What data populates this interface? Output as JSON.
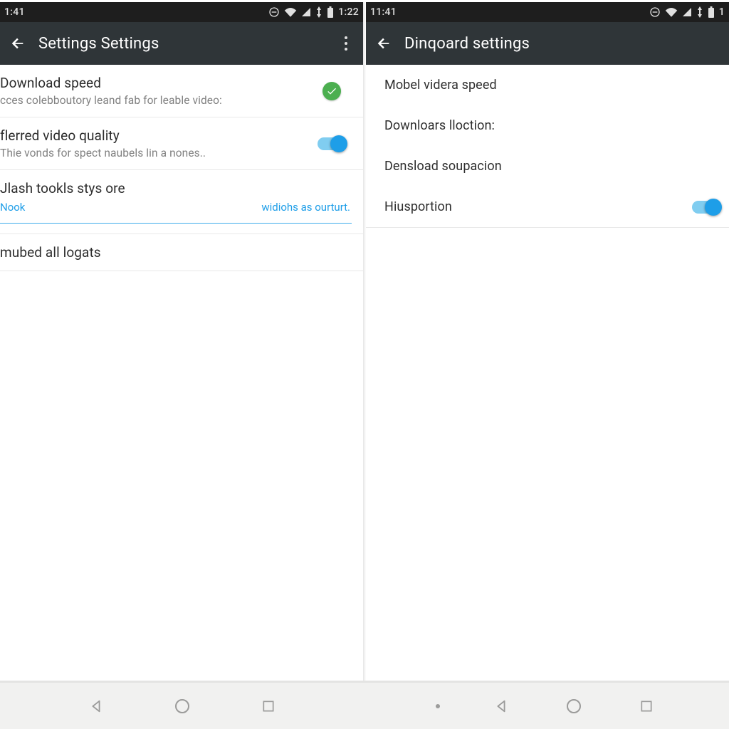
{
  "colors": {
    "toolbar": "#2f3538",
    "status": "#1e1e1e",
    "accent": "#1e9ee8",
    "success": "#4caf50"
  },
  "left": {
    "status": {
      "time_left": "1:41",
      "time_right": "1:22"
    },
    "appbar": {
      "title": "Settings Settings"
    },
    "rows": [
      {
        "title": "Download speed",
        "sub": "cces colebboutory leand fab for leable video:",
        "check": true
      },
      {
        "title": "flerred video quality",
        "sub": "Thie vonds for spect naubels lin a nones..",
        "switch": true
      },
      {
        "title": "Jlash tookls stys ore",
        "link_left": "Nook",
        "link_right": "widiohs as ourturt."
      },
      {
        "title": "mubed all logats"
      }
    ]
  },
  "right": {
    "status": {
      "time_left": "11:41",
      "time_right": "1"
    },
    "appbar": {
      "title": "Dinqoard settings"
    },
    "rows": [
      {
        "title": "Mobel videra speed"
      },
      {
        "title": "Downloars lloction:"
      },
      {
        "title": "Densload soupacion"
      },
      {
        "title": "Hiusportion",
        "switch": true
      }
    ]
  }
}
